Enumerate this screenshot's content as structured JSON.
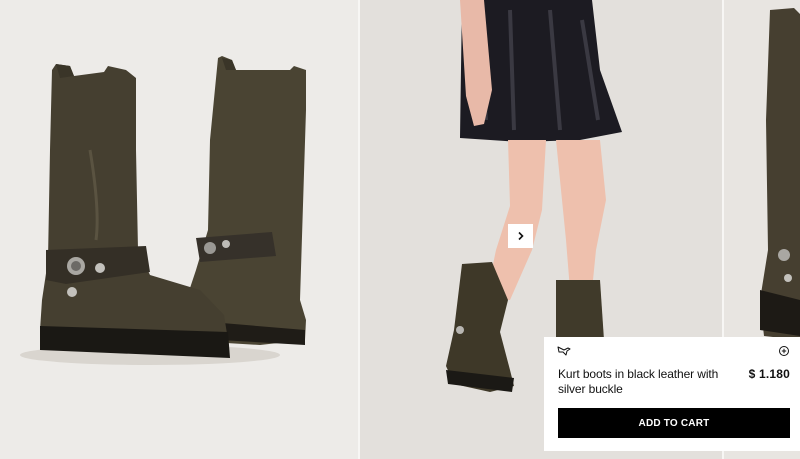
{
  "product": {
    "title": "Kurt boots in black leather with silver buckle",
    "price": "$ 1.180",
    "add_to_cart_label": "ADD TO CART"
  },
  "icons": {
    "wishlist": "bird-outline-icon",
    "info": "plus-circle-icon",
    "next": "chevron-right-icon"
  },
  "colors": {
    "cart_button": "#000000",
    "card_background": "#ffffff",
    "boot_leather": "#3f3a2d"
  }
}
